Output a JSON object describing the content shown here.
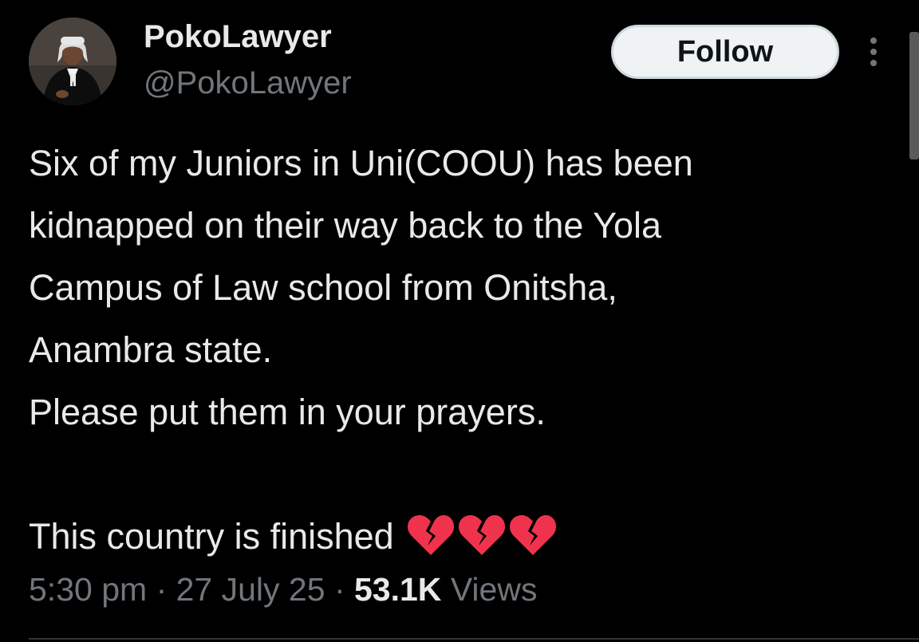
{
  "author": {
    "display_name": "PokoLawyer",
    "handle": "@PokoLawyer",
    "avatar_icon": "profile-photo-lawyer-in-wig-and-gown"
  },
  "actions": {
    "follow_label": "Follow",
    "more_icon": "vertical-ellipsis-icon"
  },
  "tweet": {
    "lines": [
      "Six of my Juniors in Uni(COOU) has been",
      "kidnapped on their way back to the Yola",
      "Campus of Law school from Onitsha,",
      "Anambra state.",
      "Please put them in your prayers.",
      "",
      "This country is finished"
    ],
    "emoji": [
      "💔",
      "💔",
      "💔"
    ]
  },
  "meta": {
    "time": "5:30 pm",
    "separator": "·",
    "date": "27 July 25",
    "views_count": "53.1K",
    "views_label": "Views"
  },
  "colors": {
    "background": "#000000",
    "primary_text": "#e7e9ea",
    "secondary_text": "#71767b",
    "button_bg": "#eff3f4",
    "heart": "#f0334d"
  }
}
